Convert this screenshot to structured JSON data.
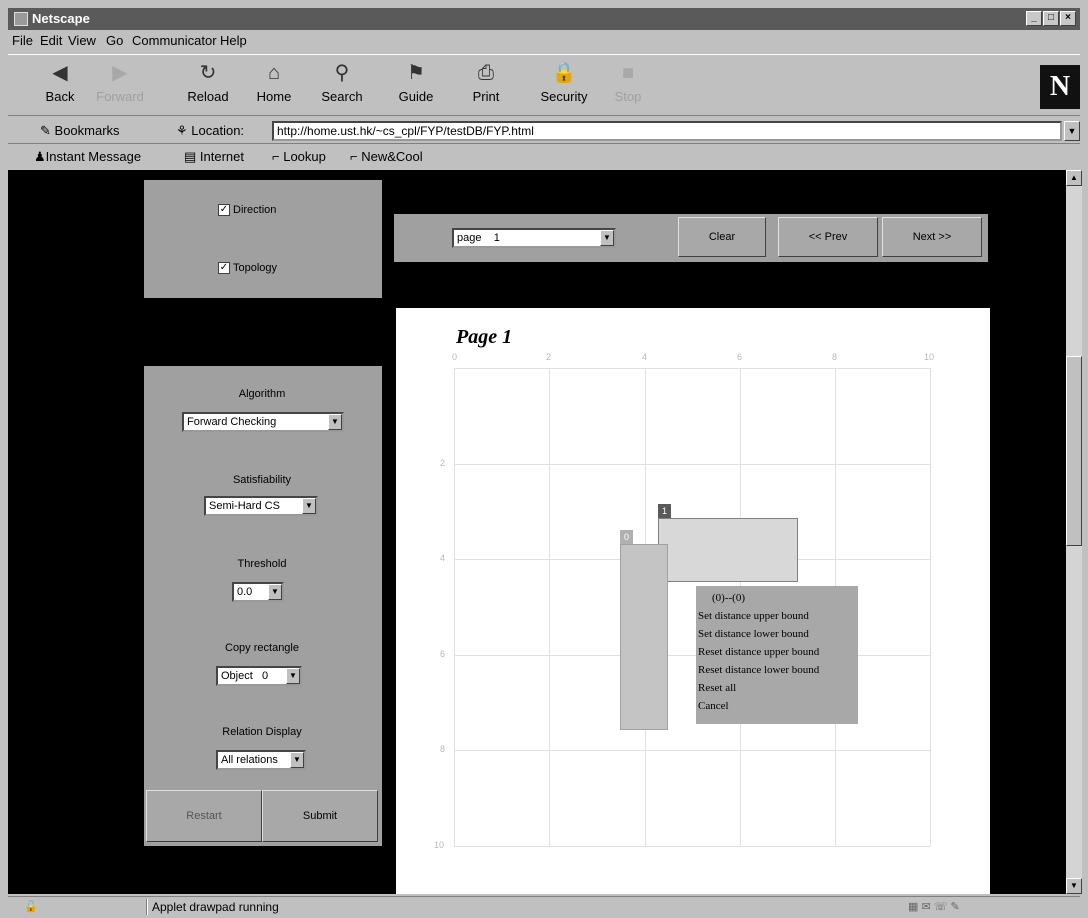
{
  "window": {
    "title": "Netscape"
  },
  "menu": [
    "File",
    "Edit",
    "View",
    "Go",
    "Communicator",
    "Help"
  ],
  "toolbar": [
    {
      "label": "Back",
      "icon": "back-icon",
      "enabled": true
    },
    {
      "label": "Forward",
      "icon": "forward-icon",
      "enabled": false
    },
    {
      "label": "Reload",
      "icon": "reload-icon",
      "enabled": true
    },
    {
      "label": "Home",
      "icon": "home-icon",
      "enabled": true
    },
    {
      "label": "Search",
      "icon": "search-icon",
      "enabled": true
    },
    {
      "label": "Guide",
      "icon": "guide-icon",
      "enabled": true
    },
    {
      "label": "Print",
      "icon": "print-icon",
      "enabled": true
    },
    {
      "label": "Security",
      "icon": "security-icon",
      "enabled": true
    },
    {
      "label": "Stop",
      "icon": "stop-icon",
      "enabled": false
    }
  ],
  "location": {
    "bookmarks": "Bookmarks",
    "label": "Location:",
    "url": "http://home.ust.hk/~cs_cpl/FYP/testDB/FYP.html"
  },
  "personal": [
    "Instant Message",
    "Internet",
    "Lookup",
    "New&Cool"
  ],
  "options": {
    "direction": {
      "label": "Direction",
      "checked": true
    },
    "topology": {
      "label": "Topology",
      "checked": true
    }
  },
  "nav": {
    "page_select": "page    1",
    "clear": "Clear",
    "prev": "<< Prev",
    "next": "Next >>"
  },
  "settings": {
    "algorithm_label": "Algorithm",
    "algorithm_value": "Forward Checking",
    "satisfiability_label": "Satisfiability",
    "satisfiability_value": "Semi-Hard CS",
    "threshold_label": "Threshold",
    "threshold_value": "0.0",
    "copy_label": "Copy rectangle",
    "copy_value": "Object   0",
    "relation_label": "Relation Display",
    "relation_value": "All relations",
    "restart": "Restart",
    "submit": "Submit"
  },
  "canvas": {
    "title": "Page 1",
    "x_ticks": [
      "0",
      "2",
      "4",
      "6",
      "8",
      "10"
    ],
    "y_ticks": [
      "2",
      "4",
      "6",
      "8",
      "10"
    ],
    "rect_labels": [
      "1",
      "0"
    ]
  },
  "context_menu": {
    "header": "(0)--(0)",
    "items": [
      "Set distance upper bound",
      "Set distance lower bound",
      "Reset distance upper bound",
      "Reset distance lower bound",
      "Reset all",
      "Cancel"
    ]
  },
  "status": {
    "text": "Applet drawpad running"
  }
}
